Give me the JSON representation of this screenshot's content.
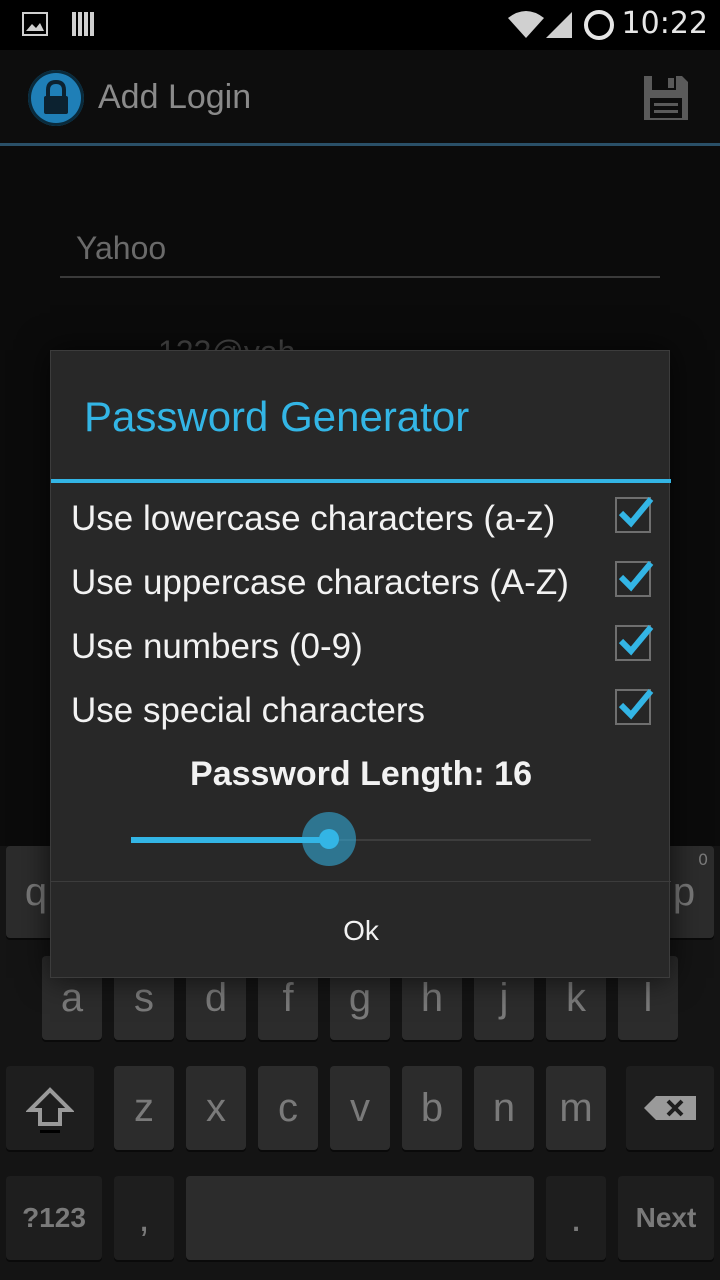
{
  "status_bar": {
    "time": "10:22"
  },
  "action_bar": {
    "title": "Add Login"
  },
  "form": {
    "site_value": "Yahoo",
    "email_partial": "123@yah"
  },
  "dialog": {
    "title": "Password Generator",
    "options": [
      {
        "label": "Use lowercase characters (a-z)",
        "checked": true
      },
      {
        "label": "Use uppercase characters (A-Z)",
        "checked": true
      },
      {
        "label": "Use numbers (0-9)",
        "checked": true
      },
      {
        "label": "Use special characters",
        "checked": true
      }
    ],
    "length_label": "Password Length: 16",
    "slider_fraction": 0.43,
    "ok_label": "Ok"
  },
  "keyboard": {
    "row1": [
      "q",
      "p"
    ],
    "row1_hint": "0",
    "row2": [
      "a",
      "s",
      "d",
      "f",
      "g",
      "h",
      "j",
      "k",
      "l"
    ],
    "row3": [
      "z",
      "x",
      "c",
      "v",
      "b",
      "n",
      "m"
    ],
    "symbols_label": "?123",
    "comma": ",",
    "period": ".",
    "next_label": "Next"
  },
  "colors": {
    "accent": "#33b5e5",
    "dialog_bg": "#282828"
  }
}
